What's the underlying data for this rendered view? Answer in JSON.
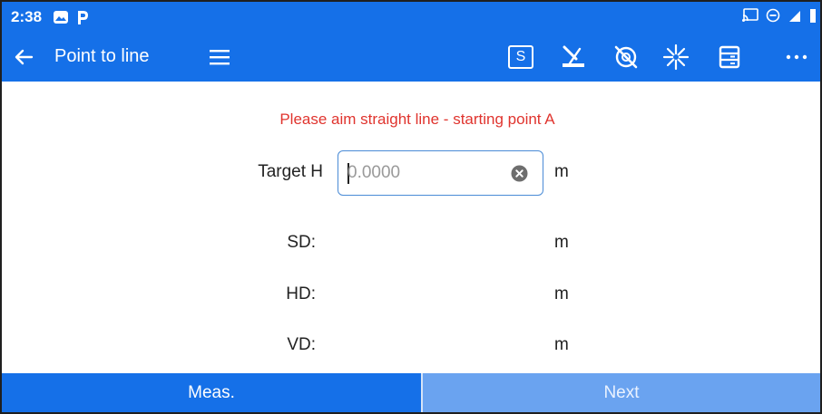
{
  "status_bar": {
    "time": "2:38",
    "icons": [
      "gallery-icon",
      "parking-app-icon",
      "cast-icon",
      "do-not-disturb-icon",
      "signal-icon",
      "battery-icon"
    ]
  },
  "app_bar": {
    "title": "Point to line",
    "s_button_label": "S",
    "icons": [
      "back-arrow-icon",
      "menu-icon",
      "s-mode-icon",
      "instrument-icon",
      "compass-off-icon",
      "laser-icon",
      "list-icon",
      "more-icon"
    ]
  },
  "main": {
    "prompt": "Please aim straight line - starting point A",
    "target_h": {
      "label": "Target H",
      "value": "",
      "placeholder": "0.0000",
      "unit": "m"
    },
    "rows": [
      {
        "label": "SD:",
        "value": "",
        "unit": "m"
      },
      {
        "label": "HD:",
        "value": "",
        "unit": "m"
      },
      {
        "label": "VD:",
        "value": "",
        "unit": "m"
      }
    ]
  },
  "bottom_bar": {
    "meas_label": "Meas.",
    "next_label": "Next"
  },
  "colors": {
    "primary": "#1570e8",
    "disabled_button": "#6aa3f0",
    "prompt_text": "#e0342e",
    "input_border": "#4a8bd6"
  }
}
